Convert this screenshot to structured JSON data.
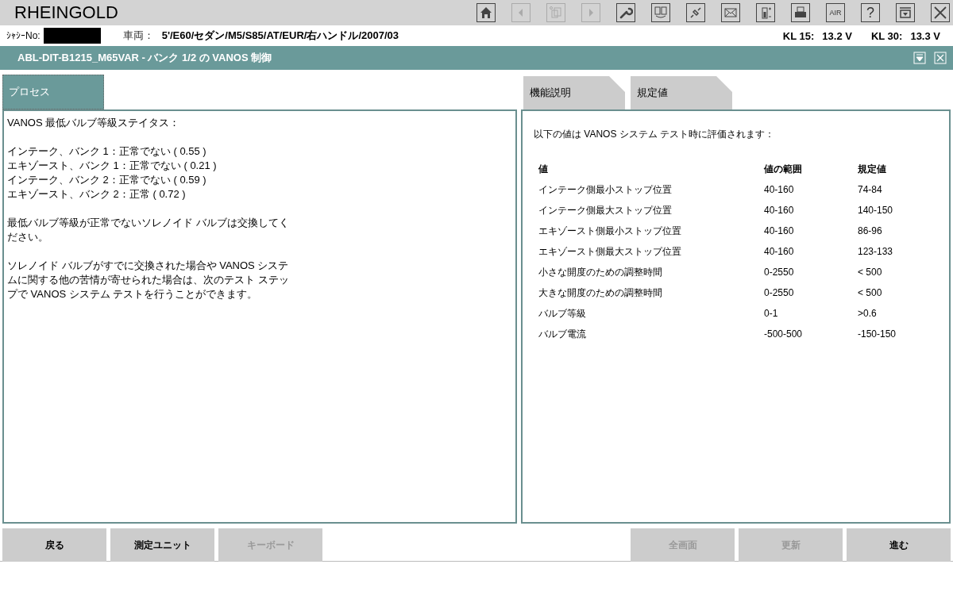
{
  "app": {
    "title": "RHEINGOLD"
  },
  "toolbar": [
    {
      "kind": "home",
      "disabled": false
    },
    {
      "kind": "back",
      "disabled": true
    },
    {
      "kind": "documents",
      "disabled": true
    },
    {
      "kind": "play",
      "disabled": true
    },
    {
      "kind": "wrench",
      "disabled": false
    },
    {
      "kind": "swap",
      "disabled": false
    },
    {
      "kind": "plug",
      "disabled": false
    },
    {
      "kind": "mail",
      "disabled": false
    },
    {
      "kind": "battery",
      "disabled": false
    },
    {
      "kind": "printer",
      "disabled": false
    },
    {
      "kind": "air",
      "label": "AIR",
      "disabled": false
    },
    {
      "kind": "help",
      "label": "?",
      "disabled": false
    },
    {
      "kind": "panel",
      "disabled": false
    },
    {
      "kind": "close",
      "disabled": false
    }
  ],
  "vehicle_bar": {
    "chassis_label": "ｼｬｼｰNo:",
    "vehicle_label": "車両：",
    "vehicle": "5'/E60/セダン/M5/S85/AT/EUR/右ハンドル/2007/03",
    "kl15_label": "KL 15:",
    "kl15": "13.2 V",
    "kl30_label": "KL 30:",
    "kl30": "13.3 V"
  },
  "header": {
    "title": "ABL-DIT-B1215_M65VAR  -  バンク 1/2 の VANOS 制御"
  },
  "left_tabs": [
    {
      "label": "プロセス",
      "selected": true
    }
  ],
  "left_text": [
    [
      "VANOS 最低バルブ等級ステイタス："
    ],
    [
      "インテーク、バンク 1：正常でない ( 0.55 )",
      "エキゾースト、バンク 1：正常でない ( 0.21 )",
      "インテーク、バンク 2：正常でない ( 0.59 )",
      "エキゾースト、バンク 2：正常 ( 0.72 )"
    ],
    [
      "最低バルブ等級が正常でないソレノイド バルブは交換してください。"
    ],
    [
      "ソレノイド バルブがすでに交換された場合や VANOS システムに関する他の苦情が寄せられた場合は、次のテスト ステップで VANOS システム テストを行うことができます。"
    ]
  ],
  "right_tabs": [
    {
      "label": "機能説明",
      "selected": false
    },
    {
      "label": "規定値",
      "selected": false
    }
  ],
  "right_intro": "以下の値は VANOS システム テスト時に評価されます：",
  "table": {
    "columns": [
      "値",
      "値の範囲",
      "規定値"
    ],
    "rows": [
      [
        "インテーク側最小ストップ位置",
        "40-160",
        "74-84"
      ],
      [
        "インテーク側最大ストップ位置",
        "40-160",
        "140-150"
      ],
      [
        "エキゾースト側最小ストップ位置",
        "40-160",
        "86-96"
      ],
      [
        "エキゾースト側最大ストップ位置",
        "40-160",
        "123-133"
      ],
      [
        "小さな開度のための調整時間",
        "0-2550",
        "< 500"
      ],
      [
        "大きな開度のための調整時間",
        "0-2550",
        "< 500"
      ],
      [
        "バルブ等級",
        "0-1",
        ">0.6"
      ],
      [
        "バルブ電流",
        "-500-500",
        "-150-150"
      ]
    ]
  },
  "buttons_left": [
    {
      "label": "戻る",
      "disabled": false
    },
    {
      "label": "測定ユニット",
      "disabled": false
    },
    {
      "label": "キーボード",
      "disabled": true
    }
  ],
  "buttons_right": [
    {
      "label": "全画面",
      "disabled": true
    },
    {
      "label": "更新",
      "disabled": true
    },
    {
      "label": "進む",
      "disabled": false
    }
  ]
}
